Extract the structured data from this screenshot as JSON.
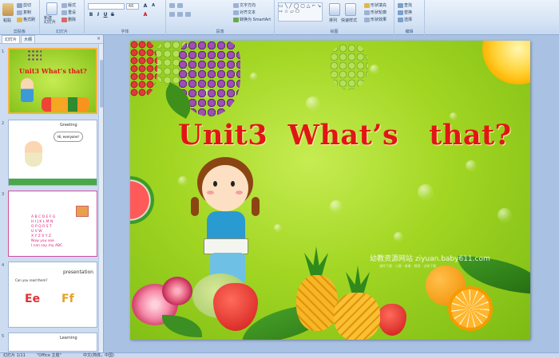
{
  "ribbon": {
    "groups": [
      {
        "label": "剪贴板"
      },
      {
        "label": "幻灯片"
      },
      {
        "label": "字体"
      },
      {
        "label": "段落"
      },
      {
        "label": "绘图"
      },
      {
        "label": "编辑"
      }
    ],
    "clipboard": {
      "paste": "粘贴",
      "cut": "剪切",
      "copy": "复制",
      "format_painter": "格式刷"
    },
    "slides": {
      "new_slide": "新建\n幻灯片",
      "layout": "版式",
      "reset": "重设",
      "delete": "删除"
    },
    "font": {
      "font_name": "",
      "font_size": "66"
    },
    "paragraph": {
      "text_direction": "文字方向",
      "align_text": "对齐文本",
      "smartart": "转换为 SmartArt"
    },
    "drawing": {
      "arrange": "排列",
      "quick_styles": "快速样式",
      "shape_fill": "形状填充",
      "shape_outline": "形状轮廓",
      "shape_effects": "形状效果"
    },
    "editing": {
      "find": "查找",
      "replace": "替换",
      "select": "选择"
    }
  },
  "panel": {
    "tab_slides": "幻灯片",
    "tab_outline": "大纲",
    "close": "×",
    "thumbnails": [
      {
        "num": "1",
        "title": "Unit3 What’s that?"
      },
      {
        "num": "2",
        "title": "Greeting",
        "bubble": "Hi, everyone!"
      },
      {
        "num": "3",
        "lines": [
          "A B C D E F G",
          "H I J K L M N",
          "O P Q R S T",
          "U V W",
          "X Y Z X Y Z",
          "Now you see",
          "I can say my ABC"
        ]
      },
      {
        "num": "4",
        "title": "presentation",
        "sub": "Can you read them?",
        "letters1": "Ee",
        "letters2": "Ff"
      },
      {
        "num": "5",
        "title": "Learning"
      }
    ]
  },
  "slide": {
    "title": "Unit3  What’s   that?",
    "watermark": "幼教资源网站  ziyuan.baby611.com",
    "watermark_sub": "课件下载 · 儿歌 · 故事 · 教案 · 试卷下载"
  },
  "status": {
    "slide_info": "幻灯片 1/11",
    "theme": "\"Office 主题\"",
    "language": "中文(简体，中国)"
  },
  "colors": {
    "title_red": "#e01616",
    "ribbon_bg": "#d3e2f4",
    "selection": "#f5b342"
  }
}
